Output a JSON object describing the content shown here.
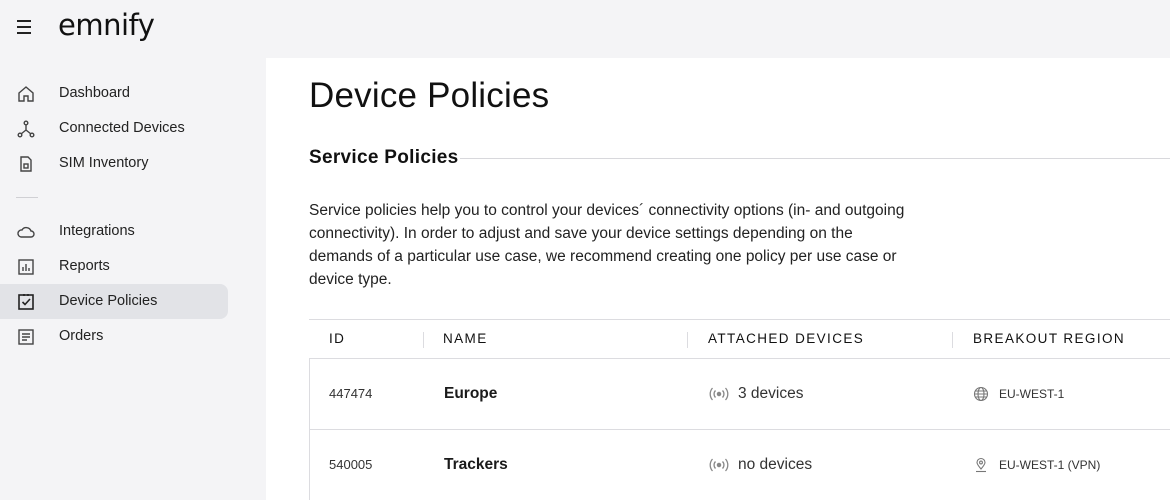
{
  "app": {
    "logo": "emnify"
  },
  "sidebar": {
    "items": [
      {
        "label": "Dashboard",
        "icon": "home-icon"
      },
      {
        "label": "Connected Devices",
        "icon": "network-icon"
      },
      {
        "label": "SIM Inventory",
        "icon": "sim-card-icon"
      },
      {
        "label": "Integrations",
        "icon": "cloud-icon"
      },
      {
        "label": "Reports",
        "icon": "bar-chart-icon"
      },
      {
        "label": "Device Policies",
        "icon": "checklist-icon",
        "active": true
      },
      {
        "label": "Orders",
        "icon": "document-icon"
      }
    ]
  },
  "main": {
    "title": "Device Policies",
    "section_title": "Service Policies",
    "description": "Service policies help you to control your devices´ connectivity options (in- and outgoing connectivity). In order to adjust and save your device settings depending on the demands of a particular use case, we recommend creating one policy per use case or device type."
  },
  "table": {
    "columns": [
      "ID",
      "NAME",
      "ATTACHED DEVICES",
      "BREAKOUT REGION"
    ],
    "rows": [
      {
        "id": "447474",
        "name": "Europe",
        "devices": "3 devices",
        "region": "EU-WEST-1",
        "region_icon": "globe-icon"
      },
      {
        "id": "540005",
        "name": "Trackers",
        "devices": "no devices",
        "region": "EU-WEST-1 (VPN)",
        "region_icon": "location-pin-icon"
      }
    ]
  }
}
